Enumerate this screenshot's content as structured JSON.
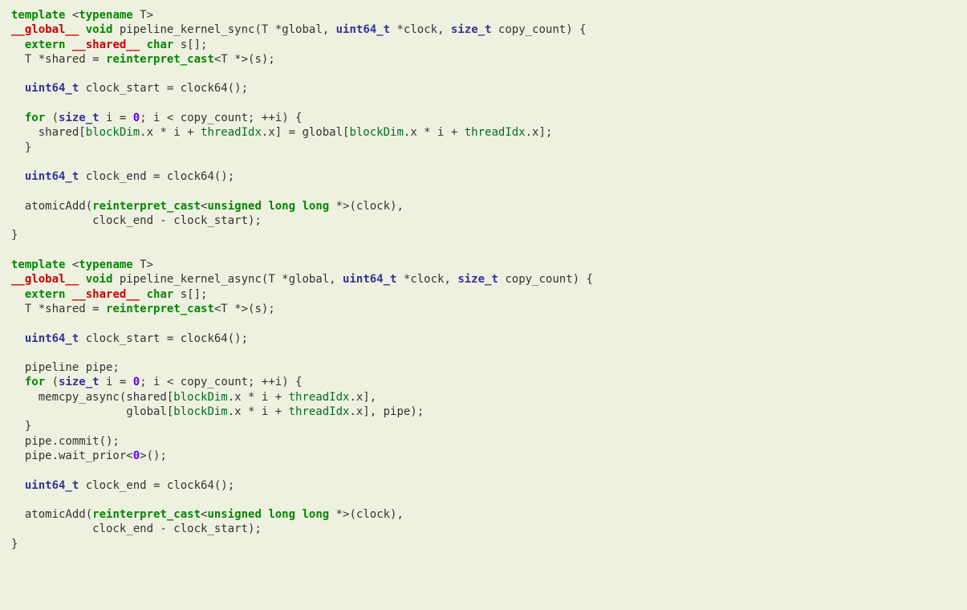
{
  "func1": {
    "l1_a": "template",
    "l1_b": " <",
    "l1_c": "typename",
    "l1_d": " T>",
    "l2_a": "__global__",
    "l2_b": " ",
    "l2_c": "void",
    "l2_d": " pipeline_kernel_sync(T *global, ",
    "l2_e": "uint64_t",
    "l2_f": " *clock, ",
    "l2_g": "size_t",
    "l2_h": " copy_count) {",
    "l3_a": "  ",
    "l3_b": "extern",
    "l3_c": " ",
    "l3_d": "__shared__",
    "l3_e": " ",
    "l3_f": "char",
    "l3_g": " s[];",
    "l4_a": "  T *shared = ",
    "l4_b": "reinterpret_cast",
    "l4_c": "<T *>(s);",
    "l5": "",
    "l6_a": "  ",
    "l6_b": "uint64_t",
    "l6_c": " clock_start = clock64();",
    "l7": "",
    "l8_a": "  ",
    "l8_b": "for",
    "l8_c": " (",
    "l8_d": "size_t",
    "l8_e": " i = ",
    "l8_f": "0",
    "l8_g": "; i < copy_count; ++i) {",
    "l9_a": "    shared[",
    "l9_b": "blockDim",
    "l9_c": ".x * i + ",
    "l9_d": "threadIdx",
    "l9_e": ".x] = global[",
    "l9_f": "blockDim",
    "l9_g": ".x * i + ",
    "l9_h": "threadIdx",
    "l9_i": ".x];",
    "l10": "  }",
    "l11": "",
    "l12_a": "  ",
    "l12_b": "uint64_t",
    "l12_c": " clock_end = clock64();",
    "l13": "",
    "l14_a": "  atomicAdd(",
    "l14_b": "reinterpret_cast",
    "l14_c": "<",
    "l14_d": "unsigned",
    "l14_e": " ",
    "l14_f": "long",
    "l14_g": " ",
    "l14_h": "long",
    "l14_i": " *>(clock),",
    "l15": "            clock_end - clock_start);",
    "l16": "}"
  },
  "blank17": "",
  "func2": {
    "l1_a": "template",
    "l1_b": " <",
    "l1_c": "typename",
    "l1_d": " T>",
    "l2_a": "__global__",
    "l2_b": " ",
    "l2_c": "void",
    "l2_d": " pipeline_kernel_async(T *global, ",
    "l2_e": "uint64_t",
    "l2_f": " *clock, ",
    "l2_g": "size_t",
    "l2_h": " copy_count) {",
    "l3_a": "  ",
    "l3_b": "extern",
    "l3_c": " ",
    "l3_d": "__shared__",
    "l3_e": " ",
    "l3_f": "char",
    "l3_g": " s[];",
    "l4_a": "  T *shared = ",
    "l4_b": "reinterpret_cast",
    "l4_c": "<T *>(s);",
    "l5": "",
    "l6_a": "  ",
    "l6_b": "uint64_t",
    "l6_c": " clock_start = clock64();",
    "l7": "",
    "l8": "  pipeline pipe;",
    "l9_a": "  ",
    "l9_b": "for",
    "l9_c": " (",
    "l9_d": "size_t",
    "l9_e": " i = ",
    "l9_f": "0",
    "l9_g": "; i < copy_count; ++i) {",
    "l10_a": "    memcpy_async(shared[",
    "l10_b": "blockDim",
    "l10_c": ".x * i + ",
    "l10_d": "threadIdx",
    "l10_e": ".x],",
    "l11_a": "                 global[",
    "l11_b": "blockDim",
    "l11_c": ".x * i + ",
    "l11_d": "threadIdx",
    "l11_e": ".x], pipe);",
    "l12": "  }",
    "l13": "  pipe.commit();",
    "l14_a": "  pipe.wait_prior<",
    "l14_b": "0",
    "l14_c": ">();",
    "l15": "",
    "l16_a": "  ",
    "l16_b": "uint64_t",
    "l16_c": " clock_end = clock64();",
    "l17": "",
    "l18_a": "  atomicAdd(",
    "l18_b": "reinterpret_cast",
    "l18_c": "<",
    "l18_d": "unsigned",
    "l18_e": " ",
    "l18_f": "long",
    "l18_g": " ",
    "l18_h": "long",
    "l18_i": " *>(clock),",
    "l19": "            clock_end - clock_start);",
    "l20": "}"
  }
}
